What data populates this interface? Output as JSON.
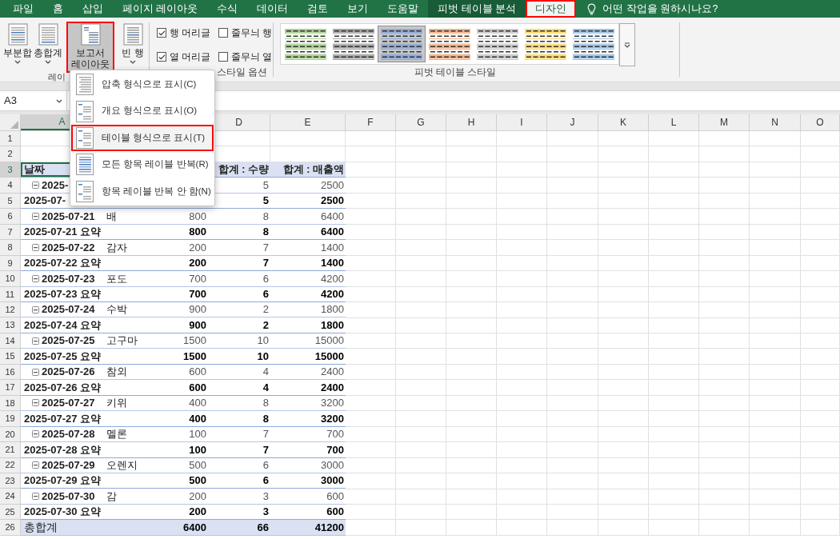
{
  "menu_tabs": [
    {
      "label": "파일",
      "selected": false
    },
    {
      "label": "홈",
      "selected": false
    },
    {
      "label": "삽입",
      "selected": false
    },
    {
      "label": "페이지 레이아웃",
      "selected": false
    },
    {
      "label": "수식",
      "selected": false
    },
    {
      "label": "데이터",
      "selected": false
    },
    {
      "label": "검토",
      "selected": false
    },
    {
      "label": "보기",
      "selected": false
    },
    {
      "label": "도움말",
      "selected": false
    },
    {
      "label": "피벗 테이블 분석",
      "selected": false,
      "kind": "context"
    },
    {
      "label": "디자인",
      "selected": true,
      "kind": "context"
    }
  ],
  "tell_me": {
    "placeholder": "어떤 작업을 원하시나요?"
  },
  "layout_group": {
    "label": "레이",
    "buttons": [
      {
        "label": "부분합",
        "pressed": false,
        "kind": "sheet"
      },
      {
        "label": "총합계",
        "pressed": false,
        "kind": "grid"
      },
      {
        "label": "보고서 레이아웃",
        "pressed": true,
        "kind": "report"
      },
      {
        "label": "빈 행",
        "pressed": false,
        "kind": "blank"
      }
    ]
  },
  "style_options": {
    "label": "스타일 옵션",
    "checkboxes": [
      {
        "label": "행 머리글",
        "checked": true
      },
      {
        "label": "줄무늬 행",
        "checked": false
      },
      {
        "label": "열 머리글",
        "checked": true
      },
      {
        "label": "줄무늬 열",
        "checked": false
      }
    ]
  },
  "styles_gallery": {
    "label": "피벗 테이블 스타일",
    "styles": [
      {
        "color": "#a9d08e",
        "selected": false
      },
      {
        "color": "#a5a5a5",
        "selected": false
      },
      {
        "color": "#8ea9db",
        "selected": true
      },
      {
        "color": "#f4b084",
        "selected": false
      },
      {
        "color": "#c9c9c9",
        "selected": false
      },
      {
        "color": "#ffd966",
        "selected": false
      },
      {
        "color": "#9bc2e6",
        "selected": false
      }
    ]
  },
  "name_box": {
    "value": "A3"
  },
  "dropdown_menu": {
    "items": [
      {
        "label": "압축 형식으로 표시(C)",
        "highlighted": false,
        "kind": "compact"
      },
      {
        "label": "개요 형식으로 표시(O)",
        "highlighted": false,
        "kind": "outline"
      },
      {
        "label": "테이블 형식으로 표시(T)",
        "highlighted": true,
        "kind": "outline"
      },
      {
        "label": "모든 항목 레이블 반복(R)",
        "highlighted": false,
        "kind": "repeat"
      },
      {
        "label": "항목 레이블 반복 안 함(N)",
        "highlighted": false,
        "kind": "outline"
      }
    ]
  },
  "column_headers": [
    {
      "label": "A",
      "selected": true
    },
    {
      "label": "D",
      "selected": false
    },
    {
      "label": "E",
      "selected": false
    },
    {
      "label": "F",
      "selected": false
    },
    {
      "label": "G",
      "selected": false
    },
    {
      "label": "H",
      "selected": false
    },
    {
      "label": "I",
      "selected": false
    },
    {
      "label": "J",
      "selected": false
    },
    {
      "label": "K",
      "selected": false
    },
    {
      "label": "L",
      "selected": false
    },
    {
      "label": "M",
      "selected": false
    },
    {
      "label": "N",
      "selected": false
    },
    {
      "label": "O",
      "selected": false
    }
  ],
  "rows": [
    {
      "number": "1",
      "kind": "empty",
      "selected": false
    },
    {
      "number": "2",
      "kind": "empty",
      "selected": false
    },
    {
      "number": "3",
      "kind": "header",
      "selected": true,
      "a": "날짜",
      "d": "합계 : 수량",
      "e": "합계 : 매출액"
    },
    {
      "number": "4",
      "kind": "detail",
      "selected": false,
      "a": "2025-",
      "d": "5",
      "e": "2500"
    },
    {
      "number": "5",
      "kind": "subtotal",
      "selected": false,
      "a": "2025-07-",
      "d": "5",
      "e": "2500"
    },
    {
      "number": "6",
      "kind": "detail",
      "selected": false,
      "a": "2025-07-21",
      "b": "배",
      "c": "800",
      "d": "8",
      "e": "6400"
    },
    {
      "number": "7",
      "kind": "subtotal",
      "selected": false,
      "a": "2025-07-21 요약",
      "c": "800",
      "d": "8",
      "e": "6400"
    },
    {
      "number": "8",
      "kind": "detail",
      "selected": false,
      "a": "2025-07-22",
      "b": "감자",
      "c": "200",
      "d": "7",
      "e": "1400"
    },
    {
      "number": "9",
      "kind": "subtotal",
      "selected": false,
      "a": "2025-07-22 요약",
      "c": "200",
      "d": "7",
      "e": "1400"
    },
    {
      "number": "10",
      "kind": "detail",
      "selected": false,
      "a": "2025-07-23",
      "b": "포도",
      "c": "700",
      "d": "6",
      "e": "4200"
    },
    {
      "number": "11",
      "kind": "subtotal",
      "selected": false,
      "a": "2025-07-23 요약",
      "c": "700",
      "d": "6",
      "e": "4200"
    },
    {
      "number": "12",
      "kind": "detail",
      "selected": false,
      "a": "2025-07-24",
      "b": "수박",
      "c": "900",
      "d": "2",
      "e": "1800"
    },
    {
      "number": "13",
      "kind": "subtotal",
      "selected": false,
      "a": "2025-07-24 요약",
      "c": "900",
      "d": "2",
      "e": "1800"
    },
    {
      "number": "14",
      "kind": "detail",
      "selected": false,
      "a": "2025-07-25",
      "b": "고구마",
      "c": "1500",
      "d": "10",
      "e": "15000"
    },
    {
      "number": "15",
      "kind": "subtotal",
      "selected": false,
      "a": "2025-07-25 요약",
      "c": "1500",
      "d": "10",
      "e": "15000"
    },
    {
      "number": "16",
      "kind": "detail",
      "selected": false,
      "a": "2025-07-26",
      "b": "참외",
      "c": "600",
      "d": "4",
      "e": "2400"
    },
    {
      "number": "17",
      "kind": "subtotal",
      "selected": false,
      "a": "2025-07-26 요약",
      "c": "600",
      "d": "4",
      "e": "2400"
    },
    {
      "number": "18",
      "kind": "detail",
      "selected": false,
      "a": "2025-07-27",
      "b": "키위",
      "c": "400",
      "d": "8",
      "e": "3200"
    },
    {
      "number": "19",
      "kind": "subtotal",
      "selected": false,
      "a": "2025-07-27 요약",
      "c": "400",
      "d": "8",
      "e": "3200"
    },
    {
      "number": "20",
      "kind": "detail",
      "selected": false,
      "a": "2025-07-28",
      "b": "멜론",
      "c": "100",
      "d": "7",
      "e": "700"
    },
    {
      "number": "21",
      "kind": "subtotal",
      "selected": false,
      "a": "2025-07-28 요약",
      "c": "100",
      "d": "7",
      "e": "700"
    },
    {
      "number": "22",
      "kind": "detail",
      "selected": false,
      "a": "2025-07-29",
      "b": "오렌지",
      "c": "500",
      "d": "6",
      "e": "3000"
    },
    {
      "number": "23",
      "kind": "subtotal",
      "selected": false,
      "a": "2025-07-29 요약",
      "c": "500",
      "d": "6",
      "e": "3000"
    },
    {
      "number": "24",
      "kind": "detail",
      "selected": false,
      "a": "2025-07-30",
      "b": "감",
      "c": "200",
      "d": "3",
      "e": "600"
    },
    {
      "number": "25",
      "kind": "subtotal",
      "selected": false,
      "a": "2025-07-30 요약",
      "c": "200",
      "d": "3",
      "e": "600"
    },
    {
      "number": "26",
      "kind": "grand_total",
      "selected": false,
      "a": "총합계",
      "c": "6400",
      "d": "66",
      "e": "41200"
    }
  ]
}
